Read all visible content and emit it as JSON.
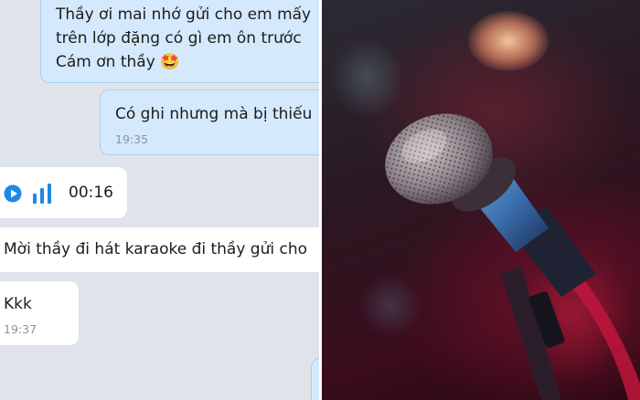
{
  "messages": {
    "m1": {
      "line1": "Thầy ơi mai nhớ gửi cho em mấy",
      "line2": "trên lớp đặng có gì em ôn trước",
      "line3": "Cám ơn thầy",
      "emoji": "🤩"
    },
    "m2": {
      "text": "Có ghi nhưng mà bị thiếu",
      "time": "19:35"
    },
    "voice": {
      "duration": "00:16"
    },
    "m3": {
      "text": "Mời thầy đi hát karaoke đi thầy gửi cho"
    },
    "m4": {
      "text": "Kkk",
      "time": "19:37"
    }
  },
  "colors": {
    "outgoing_bubble": "#d4e9fb",
    "incoming_bubble": "#ffffff",
    "chat_background": "#dfe3ea",
    "voice_accent": "#1e88e5"
  },
  "icons": {
    "play": "play-icon",
    "audio_bars": "audio-bars-icon",
    "microphone": "microphone-photo"
  }
}
